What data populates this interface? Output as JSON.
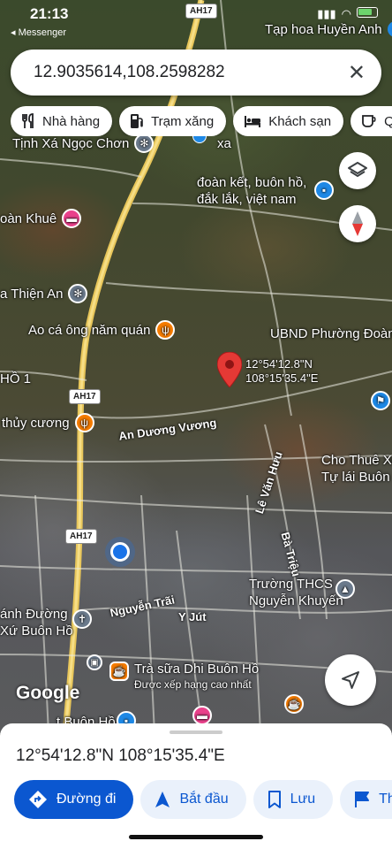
{
  "status_bar": {
    "time": "21:13",
    "back_app": "◂ Messenger"
  },
  "search": {
    "value": "12.9035614,108.2598282",
    "clear_icon": "close-icon"
  },
  "chips": [
    {
      "label": "Nhà hàng",
      "icon": "restaurant-icon"
    },
    {
      "label": "Trạm xăng",
      "icon": "gas-station-icon"
    },
    {
      "label": "Khách sạn",
      "icon": "hotel-icon"
    },
    {
      "label": "Q",
      "icon": "coffee-icon"
    }
  ],
  "map": {
    "places": {
      "tap_hoa": "Tạp hoa Huyền Anh",
      "tinh_xa": "Tịnh Xá Ngọc Chơn",
      "xa": "xa",
      "doan_ket": "đoàn kết, buôn hồ,",
      "dak_lak": "đắk lắk, việt nam",
      "doan_khue": "oàn Khuê",
      "thien_an": "a Thiện An",
      "ao_ca": "Ao cá ông năm quán",
      "ubnd": "UBND Phường Đoàn",
      "ho1": "HỒ 1",
      "thuy_cuong": "thủy cương",
      "cho_thue_1": "Cho Thuê Xe",
      "cho_thue_2": "Tự lái Buôn Hồ",
      "truong_1": "Trường THCS",
      "truong_2": "Nguyễn Khuyến",
      "thanh_duong_1": "ánh Đường",
      "thanh_duong_2": "Xứ Buôn Hồ",
      "tra_sua": "Trà sữa Dhi Buôn Hồ",
      "tra_sua_sub": "Được xếp hạng cao nhất",
      "buon_ho_bottom": "t Buôn Hồ"
    },
    "roads": {
      "an_duong_vuong": "An Dương Vương",
      "le_van_huu": "Lê Văn Hưu",
      "ba_trieu": "Bà Triệu",
      "nguyen_trai": "Nguyễn Trãi",
      "y_jut": "Y Jút"
    },
    "shields": {
      "top": "AH17",
      "mid": "AH17",
      "low": "AH17"
    },
    "pin": {
      "lat": "12°54'12.8\"N",
      "lng": "108°15'35.4\"E"
    },
    "logo": "Google"
  },
  "sheet": {
    "title": "12°54'12.8\"N 108°15'35.4\"E",
    "actions": [
      {
        "label": "Đường đi",
        "icon": "directions-icon"
      },
      {
        "label": "Bắt đầu",
        "icon": "navigation-icon"
      },
      {
        "label": "Lưu",
        "icon": "bookmark-icon"
      },
      {
        "label": "Th",
        "icon": "flag-icon"
      }
    ]
  },
  "colors": {
    "accent": "#0b57d0",
    "pin": "#e53935",
    "location_dot": "#1a73e8",
    "poi_orange": "#f57c00",
    "poi_pink": "#e9418b",
    "poi_gray": "#6b7a8c"
  }
}
